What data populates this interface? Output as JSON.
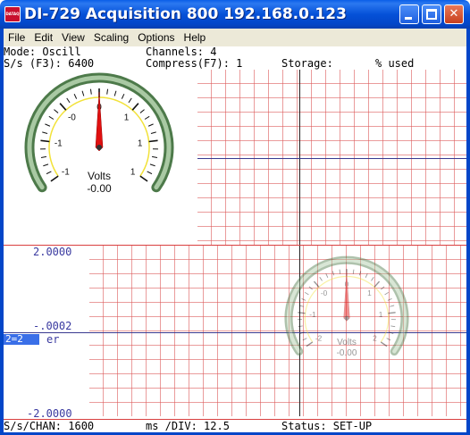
{
  "window": {
    "icon_text": "DATAQ",
    "title": "DI-729 Acquisition 800 192.168.0.123",
    "min_glyph": "",
    "max_glyph": "",
    "close_glyph": "✕"
  },
  "menu": [
    "File",
    "Edit",
    "View",
    "Scaling",
    "Options",
    "Help"
  ],
  "status_top": {
    "mode": "Mode: Oscill",
    "channels": "Channels: 4",
    "sample_rate": "S/s (F3): 6400",
    "compress": "Compress(F7): 1",
    "storage": "Storage:",
    "pct_used": "% used"
  },
  "lower_panel": {
    "top_scale": "2.0000",
    "mid_scale": "-.0002",
    "bottom_scale": "-2.0000",
    "channel_tag": "2=2",
    "channel_suffix": "er"
  },
  "gauge_main": {
    "unit": "Volts",
    "reading": "-0.00",
    "tick_labels": [
      "-1",
      "-1",
      "-0",
      "0",
      "1",
      "1",
      "1"
    ],
    "needle_value": 0.0
  },
  "gauge_ghost": {
    "unit": "Volts",
    "reading": "-0.00",
    "tick_labels": [
      "-2",
      "-1",
      "-0",
      "0",
      "1",
      "1",
      "2"
    ],
    "needle_value": 0.0
  },
  "status_bottom": {
    "sps_chan": "S/s/CHAN: 1600",
    "ms_div": "ms /DIV: 12.5",
    "status": "Status: SET-UP"
  },
  "colors": {
    "titlebar": "#0551d8",
    "grid": "#dc5050",
    "trace_blue": "#3a3a90",
    "gauge_ring": "#6f9a6a",
    "needle": "#e01010"
  }
}
